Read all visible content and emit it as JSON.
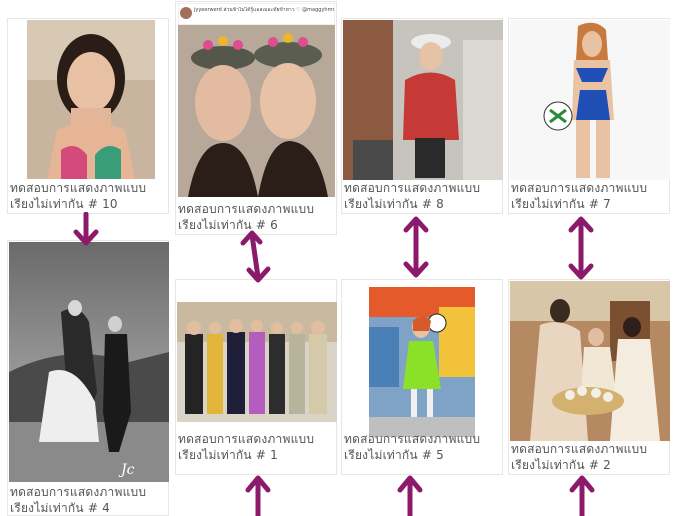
{
  "accent_color": "#8b1a6b",
  "cards": [
    {
      "id": "c10",
      "caption_l1": "ทดสอบการแสดงภาพแบบ",
      "caption_l2": "เรียงไม่เท่ากัน",
      "num": "# 10",
      "photo": "woman-portrait-bikini"
    },
    {
      "id": "c6",
      "caption_l1": "ทดสอบการแสดงภาพแบบ",
      "caption_l2": "เรียงไม่เท่ากัน",
      "num": "# 6",
      "photo": "two-women-caps-selfie",
      "header_text": "jyyeerwerd ส่วนข้าไม่ได้รู้แอลเมอะทัยข้าหาว ♡ @maggyhmrh"
    },
    {
      "id": "c8",
      "caption_l1": "ทดสอบการแสดงภาพแบบ",
      "caption_l2": "เรียงไม่เท่ากัน",
      "num": "# 8",
      "photo": "woman-red-jacket-street"
    },
    {
      "id": "c7",
      "caption_l1": "ทดสอบการแสดงภาพแบบ",
      "caption_l2": "เรียงไม่เท่ากัน",
      "num": "# 7",
      "photo": "woman-blue-swimsuit-football"
    },
    {
      "id": "c4",
      "caption_l1": "ทดสอบการแสดงภาพแบบ",
      "caption_l2": "เรียงไม่เท่ากัน",
      "num": "# 4",
      "photo": "bw-couple-horse"
    },
    {
      "id": "c1",
      "caption_l1": "ทดสอบการแสดงภาพแบบ",
      "caption_l2": "เรียงไม่เท่ากัน",
      "num": "# 1",
      "photo": "group-event-stage"
    },
    {
      "id": "c5",
      "caption_l1": "ทดสอบการแสดงภาพแบบ",
      "caption_l2": "เรียงไม่เท่ากัน",
      "num": "# 5",
      "photo": "woman-green-dress-ball"
    },
    {
      "id": "c2",
      "caption_l1": "ทดสอบการแสดงภาพแบบ",
      "caption_l2": "เรียงไม่เท่ากัน",
      "num": "# 2",
      "photo": "thai-wedding-ceremony"
    }
  ],
  "arrows": [
    {
      "name": "arrow-10-to-4",
      "type": "down-arrow"
    },
    {
      "name": "arrow-6-to-1",
      "type": "double-arrow"
    },
    {
      "name": "arrow-8-to-5",
      "type": "double-arrow"
    },
    {
      "name": "arrow-7-to-2",
      "type": "double-arrow"
    },
    {
      "name": "arrow-1-up",
      "type": "up-arrow"
    },
    {
      "name": "arrow-5-up",
      "type": "up-arrow"
    },
    {
      "name": "arrow-2-up",
      "type": "up-arrow"
    }
  ]
}
